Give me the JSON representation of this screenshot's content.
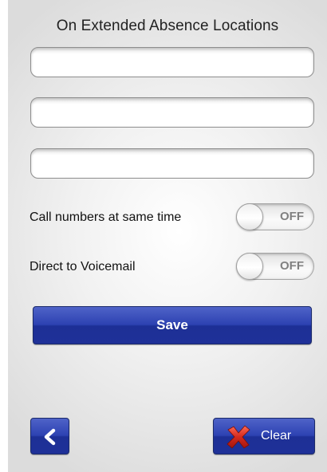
{
  "header": {
    "title": "On Extended Absence Locations"
  },
  "locations": [
    {
      "value": "",
      "placeholder": ""
    },
    {
      "value": "",
      "placeholder": ""
    },
    {
      "value": "",
      "placeholder": ""
    }
  ],
  "options": {
    "call_same_time": {
      "label": "Call numbers at same time",
      "state": "OFF"
    },
    "direct_voicemail": {
      "label": "Direct to Voicemail",
      "state": "OFF"
    }
  },
  "actions": {
    "save_label": "Save",
    "clear_label": "Clear",
    "back_icon": "chevron-left-icon",
    "clear_icon": "red-x-icon"
  },
  "colors": {
    "button_blue": "#2d42b2",
    "clear_icon_red": "#d42a1e"
  }
}
